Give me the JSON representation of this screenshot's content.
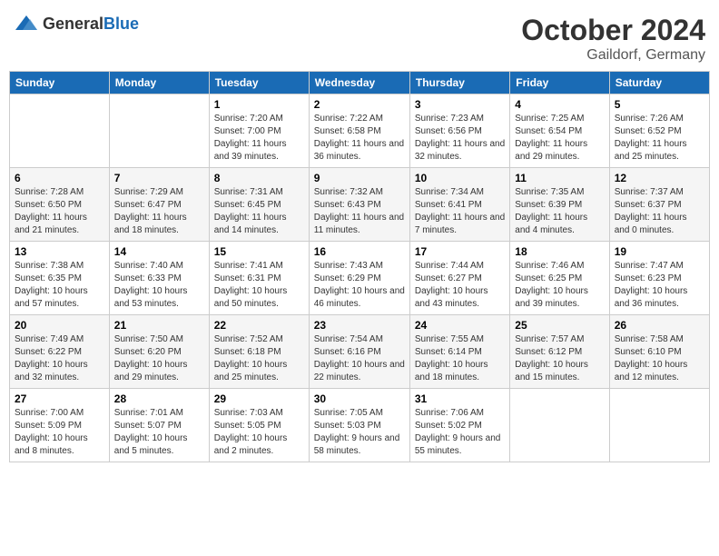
{
  "header": {
    "logo_general": "General",
    "logo_blue": "Blue",
    "month": "October 2024",
    "location": "Gaildorf, Germany"
  },
  "calendar": {
    "weekdays": [
      "Sunday",
      "Monday",
      "Tuesday",
      "Wednesday",
      "Thursday",
      "Friday",
      "Saturday"
    ],
    "weeks": [
      [
        {
          "day": "",
          "info": ""
        },
        {
          "day": "",
          "info": ""
        },
        {
          "day": "1",
          "info": "Sunrise: 7:20 AM\nSunset: 7:00 PM\nDaylight: 11 hours and 39 minutes."
        },
        {
          "day": "2",
          "info": "Sunrise: 7:22 AM\nSunset: 6:58 PM\nDaylight: 11 hours and 36 minutes."
        },
        {
          "day": "3",
          "info": "Sunrise: 7:23 AM\nSunset: 6:56 PM\nDaylight: 11 hours and 32 minutes."
        },
        {
          "day": "4",
          "info": "Sunrise: 7:25 AM\nSunset: 6:54 PM\nDaylight: 11 hours and 29 minutes."
        },
        {
          "day": "5",
          "info": "Sunrise: 7:26 AM\nSunset: 6:52 PM\nDaylight: 11 hours and 25 minutes."
        }
      ],
      [
        {
          "day": "6",
          "info": "Sunrise: 7:28 AM\nSunset: 6:50 PM\nDaylight: 11 hours and 21 minutes."
        },
        {
          "day": "7",
          "info": "Sunrise: 7:29 AM\nSunset: 6:47 PM\nDaylight: 11 hours and 18 minutes."
        },
        {
          "day": "8",
          "info": "Sunrise: 7:31 AM\nSunset: 6:45 PM\nDaylight: 11 hours and 14 minutes."
        },
        {
          "day": "9",
          "info": "Sunrise: 7:32 AM\nSunset: 6:43 PM\nDaylight: 11 hours and 11 minutes."
        },
        {
          "day": "10",
          "info": "Sunrise: 7:34 AM\nSunset: 6:41 PM\nDaylight: 11 hours and 7 minutes."
        },
        {
          "day": "11",
          "info": "Sunrise: 7:35 AM\nSunset: 6:39 PM\nDaylight: 11 hours and 4 minutes."
        },
        {
          "day": "12",
          "info": "Sunrise: 7:37 AM\nSunset: 6:37 PM\nDaylight: 11 hours and 0 minutes."
        }
      ],
      [
        {
          "day": "13",
          "info": "Sunrise: 7:38 AM\nSunset: 6:35 PM\nDaylight: 10 hours and 57 minutes."
        },
        {
          "day": "14",
          "info": "Sunrise: 7:40 AM\nSunset: 6:33 PM\nDaylight: 10 hours and 53 minutes."
        },
        {
          "day": "15",
          "info": "Sunrise: 7:41 AM\nSunset: 6:31 PM\nDaylight: 10 hours and 50 minutes."
        },
        {
          "day": "16",
          "info": "Sunrise: 7:43 AM\nSunset: 6:29 PM\nDaylight: 10 hours and 46 minutes."
        },
        {
          "day": "17",
          "info": "Sunrise: 7:44 AM\nSunset: 6:27 PM\nDaylight: 10 hours and 43 minutes."
        },
        {
          "day": "18",
          "info": "Sunrise: 7:46 AM\nSunset: 6:25 PM\nDaylight: 10 hours and 39 minutes."
        },
        {
          "day": "19",
          "info": "Sunrise: 7:47 AM\nSunset: 6:23 PM\nDaylight: 10 hours and 36 minutes."
        }
      ],
      [
        {
          "day": "20",
          "info": "Sunrise: 7:49 AM\nSunset: 6:22 PM\nDaylight: 10 hours and 32 minutes."
        },
        {
          "day": "21",
          "info": "Sunrise: 7:50 AM\nSunset: 6:20 PM\nDaylight: 10 hours and 29 minutes."
        },
        {
          "day": "22",
          "info": "Sunrise: 7:52 AM\nSunset: 6:18 PM\nDaylight: 10 hours and 25 minutes."
        },
        {
          "day": "23",
          "info": "Sunrise: 7:54 AM\nSunset: 6:16 PM\nDaylight: 10 hours and 22 minutes."
        },
        {
          "day": "24",
          "info": "Sunrise: 7:55 AM\nSunset: 6:14 PM\nDaylight: 10 hours and 18 minutes."
        },
        {
          "day": "25",
          "info": "Sunrise: 7:57 AM\nSunset: 6:12 PM\nDaylight: 10 hours and 15 minutes."
        },
        {
          "day": "26",
          "info": "Sunrise: 7:58 AM\nSunset: 6:10 PM\nDaylight: 10 hours and 12 minutes."
        }
      ],
      [
        {
          "day": "27",
          "info": "Sunrise: 7:00 AM\nSunset: 5:09 PM\nDaylight: 10 hours and 8 minutes."
        },
        {
          "day": "28",
          "info": "Sunrise: 7:01 AM\nSunset: 5:07 PM\nDaylight: 10 hours and 5 minutes."
        },
        {
          "day": "29",
          "info": "Sunrise: 7:03 AM\nSunset: 5:05 PM\nDaylight: 10 hours and 2 minutes."
        },
        {
          "day": "30",
          "info": "Sunrise: 7:05 AM\nSunset: 5:03 PM\nDaylight: 9 hours and 58 minutes."
        },
        {
          "day": "31",
          "info": "Sunrise: 7:06 AM\nSunset: 5:02 PM\nDaylight: 9 hours and 55 minutes."
        },
        {
          "day": "",
          "info": ""
        },
        {
          "day": "",
          "info": ""
        }
      ]
    ]
  }
}
